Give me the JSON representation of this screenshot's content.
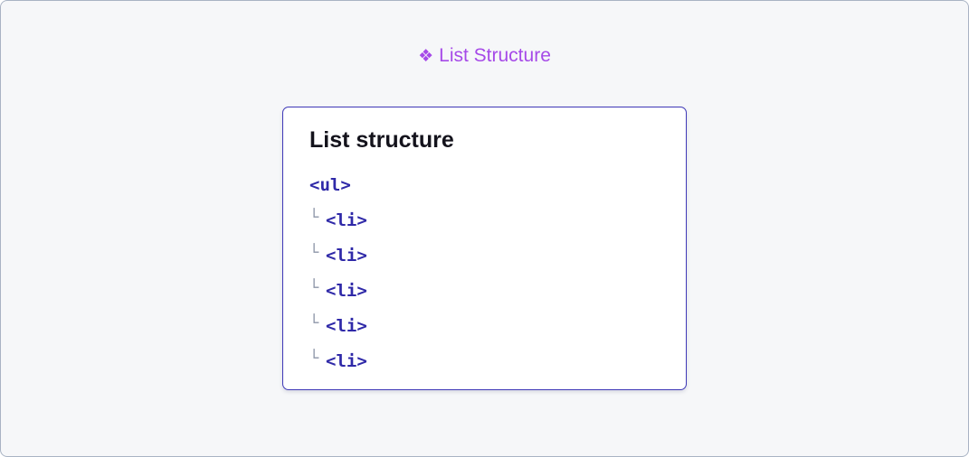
{
  "header": {
    "icon": "diamond-cluster-icon",
    "icon_glyph": "❖",
    "title": "List Structure"
  },
  "card": {
    "title": "List structure",
    "root_tag": "<ul>",
    "connector_glyph": "└",
    "children": [
      "<li>",
      "<li>",
      "<li>",
      "<li>",
      "<li>"
    ]
  },
  "colors": {
    "accent": "#a64ae8",
    "tag": "#2f29a8",
    "card_border": "#3f39b8",
    "background": "#f6f7f9"
  }
}
